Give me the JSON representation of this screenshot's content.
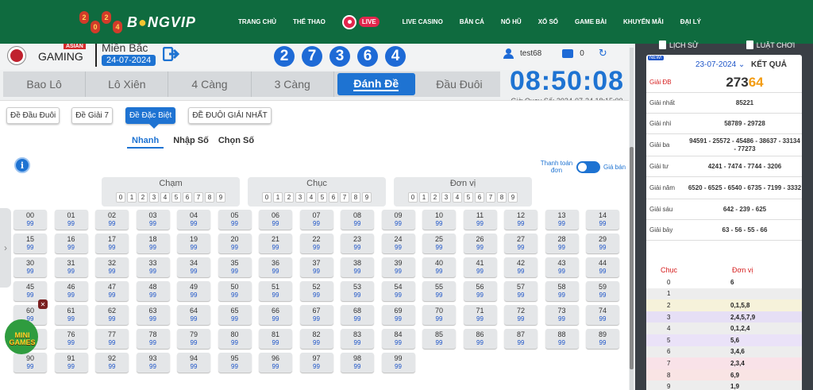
{
  "topnav": {
    "logo_digits": [
      "2",
      "0",
      "2",
      "4"
    ],
    "brand_a": "B",
    "brand_b": "NGVIP",
    "links": [
      "TRANG CHỦ",
      "THỂ THAO",
      "LIVE",
      "LIVE CASINO",
      "BẮN CÁ",
      "NỔ HŨ",
      "XỔ SỐ",
      "GAME BÀI",
      "KHUYẾN MÃI",
      "ĐẠI LÝ"
    ]
  },
  "header": {
    "vc_badge": "ASIAN",
    "vc_name": "GAMING",
    "vc_prefix": "VC",
    "region": "Miền Bắc",
    "date": "24-07-2024",
    "balls": [
      "2",
      "7",
      "3",
      "6",
      "4"
    ],
    "username": "test68",
    "balance": "0"
  },
  "tabs": [
    "Bao Lô",
    "Lô Xiên",
    "4 Càng",
    "3 Càng",
    "Đánh Đề",
    "Đầu Đuôi"
  ],
  "active_tab": "Đánh Đề",
  "clock": {
    "time": "08:50:08",
    "label": "Giờ Quay Số: 2024-07-24 18:15:00"
  },
  "subtypes": [
    "Đề Đầu Đuôi",
    "Đề Giải 7",
    "Đề Đặc Biệt",
    "ĐỀ ĐUÔI GIẢI NHẤT"
  ],
  "modes": [
    "Nhanh",
    "Nhập Số",
    "Chọn Số"
  ],
  "toggle": {
    "left": "Thanh toán đơn",
    "right": "Giá bán"
  },
  "filters": [
    {
      "title": "Chạm"
    },
    {
      "title": "Chục"
    },
    {
      "title": "Đơn vị"
    }
  ],
  "filter_digits": [
    "0",
    "1",
    "2",
    "3",
    "4",
    "5",
    "6",
    "7",
    "8",
    "9"
  ],
  "odds": "99",
  "minigames": "MINI GAMES",
  "results": {
    "tabs": [
      "LỊCH SỬ",
      "LUẬT CHƠI"
    ],
    "new": "NEW!",
    "date": "23-07-2024 ⌄",
    "title": "KẾT QUẢ",
    "db_label": "Giải ĐB",
    "db_a": "273",
    "db_b": "64",
    "rows": [
      {
        "label": "Giải nhất",
        "value": "85221"
      },
      {
        "label": "Giải nhì",
        "value": "58789 - 29728"
      },
      {
        "label": "Giải ba",
        "value": "94591 - 25572 - 45486 - 38637 - 33134 - 77273"
      },
      {
        "label": "Giải tư",
        "value": "4241 - 7474 - 7744 - 3206"
      },
      {
        "label": "Giải năm",
        "value": "6520 - 6525 - 6540 - 6735 - 7199 - 3332"
      },
      {
        "label": "Giải sáu",
        "value": "642 - 239 - 625"
      },
      {
        "label": "Giải bảy",
        "value": "63 - 56 - 55 - 66"
      }
    ],
    "cd_head": [
      "Chục",
      "Đơn vị"
    ],
    "cd_rows": [
      {
        "k": "0",
        "v": "6"
      },
      {
        "k": "1",
        "v": ""
      },
      {
        "k": "2",
        "v": "0,1,5,8"
      },
      {
        "k": "3",
        "v": "2,4,5,7,9"
      },
      {
        "k": "4",
        "v": "0,1,2,4"
      },
      {
        "k": "5",
        "v": "5,6"
      },
      {
        "k": "6",
        "v": "3,4,6"
      },
      {
        "k": "7",
        "v": "2,3,4"
      },
      {
        "k": "8",
        "v": "6,9"
      },
      {
        "k": "9",
        "v": "1,9"
      }
    ],
    "cd_colors": [
      "#ffffff",
      "#ededed",
      "#f6f2da",
      "#e6dff5",
      "#ededed",
      "#eae2f8",
      "#ededed",
      "#f9e2e8",
      "#f9e4e4",
      "#ededed"
    ]
  }
}
